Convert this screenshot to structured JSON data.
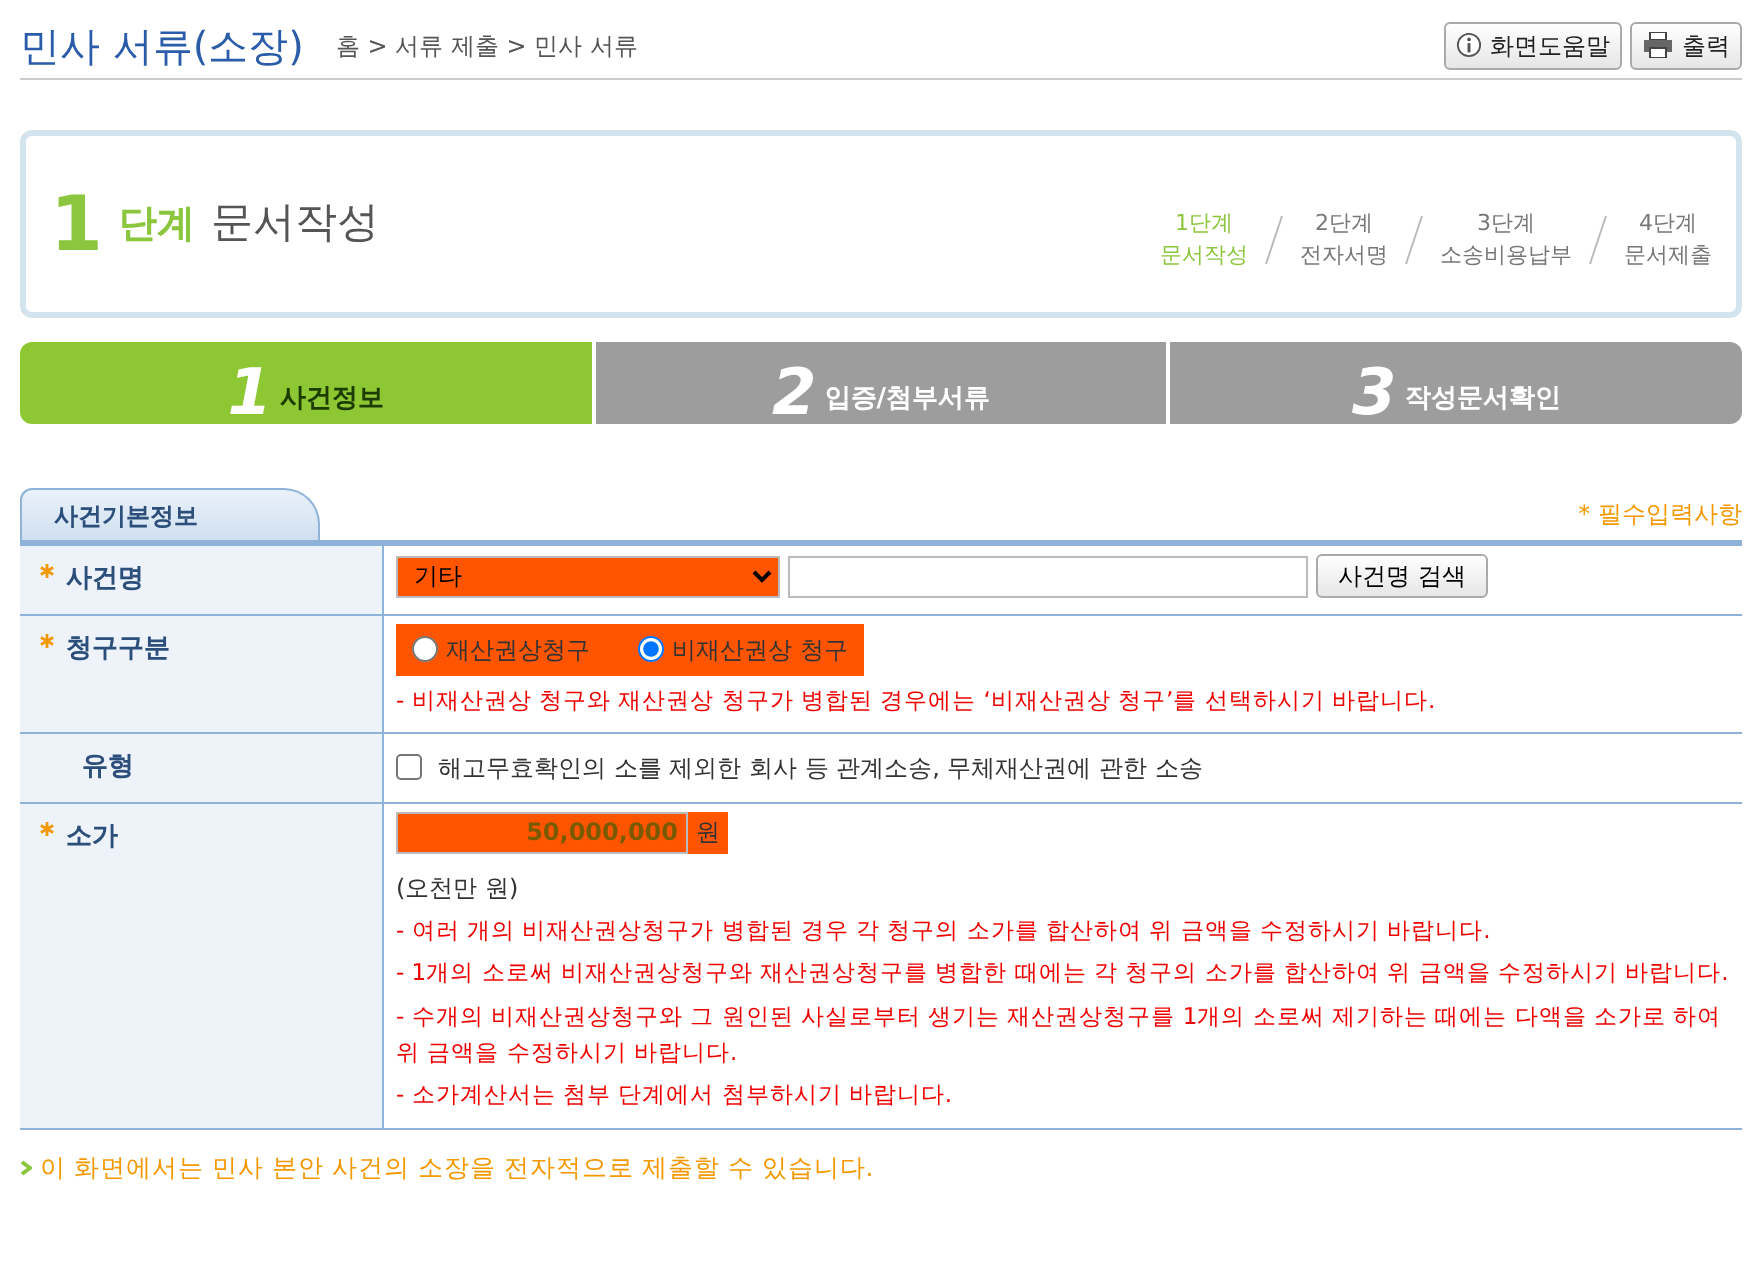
{
  "header": {
    "title": "민사 서류(소장)",
    "breadcrumb": [
      "홈",
      "서류 제출",
      "민사 서류"
    ],
    "separator": ">",
    "buttons": [
      {
        "kind": "help",
        "label": "화면도움말"
      },
      {
        "kind": "print",
        "label": "출력"
      }
    ]
  },
  "stage": {
    "number": "1",
    "unit": "단계",
    "name": "문서작성",
    "steps": [
      {
        "step": "1단계",
        "name": "문서작성",
        "selected": true
      },
      {
        "step": "2단계",
        "name": "전자서명",
        "selected": false
      },
      {
        "step": "3단계",
        "name": "소송비용납부",
        "selected": false
      },
      {
        "step": "4단계",
        "name": "문서제출",
        "selected": false
      }
    ]
  },
  "tabs": [
    {
      "number": "1",
      "label": "사건정보",
      "selected": true
    },
    {
      "number": "2",
      "label": "입증/첨부서류",
      "selected": false
    },
    {
      "number": "3",
      "label": "작성문서확인",
      "selected": false
    }
  ],
  "section": {
    "title": "사건기본정보",
    "required_note": "* 필수입력사항"
  },
  "form": {
    "rows": [
      {
        "label": "사건명",
        "required": true,
        "kind": "case_name",
        "select": "기타",
        "highlighted": true,
        "button": "사건명 검색"
      },
      {
        "label": "청구구분",
        "required": true,
        "kind": "radios",
        "highlighted": true,
        "options": [
          {
            "label": "재산권상청구",
            "selected": false
          },
          {
            "label": "비재산권상 청구",
            "selected": true
          }
        ],
        "notes": [
          "- 비재산권상 청구와 재산권상 청구가 병합된 경우에는 ‘비재산권상 청구’를 선택하시기 바랍니다."
        ]
      },
      {
        "label": "유형",
        "required": false,
        "kind": "checkbox",
        "checked": false,
        "text": "해고무효확인의 소를 제외한 회사 등 관계소송, 무체재산권에 관한 소송"
      },
      {
        "label": "소가",
        "required": true,
        "kind": "amount",
        "value": "50,000,000",
        "unit": "원",
        "highlighted": true,
        "reading": "(오천만 원)",
        "notes": [
          "- 여러 개의 비재산권상청구가 병합된 경우 각 청구의 소가를 합산하여 위 금액을 수정하시기 바랍니다.",
          "- 1개의 소로써 비재산권상청구와 재산권상청구를 병합한 때에는 각 청구의 소가를 합산하여 위 금액을 수정하시기 바랍니다.",
          "- 수개의 비재산권상청구와 그 원인된 사실로부터 생기는 재산권상청구를 1개의 소로써 제기하는 때에는 다액을 소가로 하여 위 금액을 수정하시기 바랍니다.",
          "- 소가계산서는 첨부 단계에서 첨부하시기 바랍니다."
        ]
      }
    ]
  },
  "footer_note": "이 화면에서는 민사 본안 사건의 소장을 전자적으로 제출할 수 있습니다."
}
